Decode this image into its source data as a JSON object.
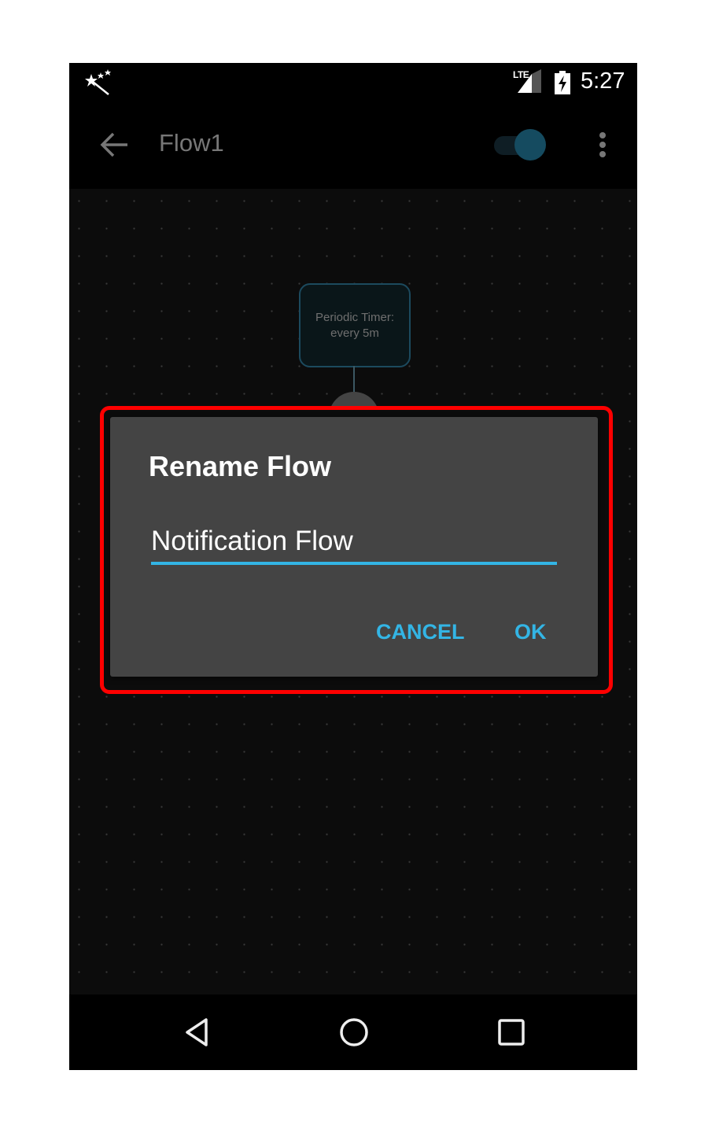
{
  "status_bar": {
    "left_icon": "magic-wand-icon",
    "network_label": "LTE",
    "signal_icon": "signal-icon",
    "battery_icon": "battery-charging-icon",
    "time": "5:27"
  },
  "app_bar": {
    "back_icon": "arrow-back-icon",
    "title": "Flow1",
    "toggle": {
      "state": "on",
      "color": "#154b60"
    },
    "menu_icon": "more-vert-icon"
  },
  "canvas": {
    "nodes": [
      {
        "line1": "Periodic Timer:",
        "line2": "every 5m"
      }
    ]
  },
  "dialog": {
    "title": "Rename Flow",
    "input_value": "Notification Flow",
    "cancel_label": "CANCEL",
    "ok_label": "OK",
    "accent_color": "#33b5e5"
  },
  "highlight_color": "#ff0000",
  "nav_bar": {
    "back": "nav-back-icon",
    "home": "nav-home-icon",
    "recents": "nav-recents-icon"
  }
}
